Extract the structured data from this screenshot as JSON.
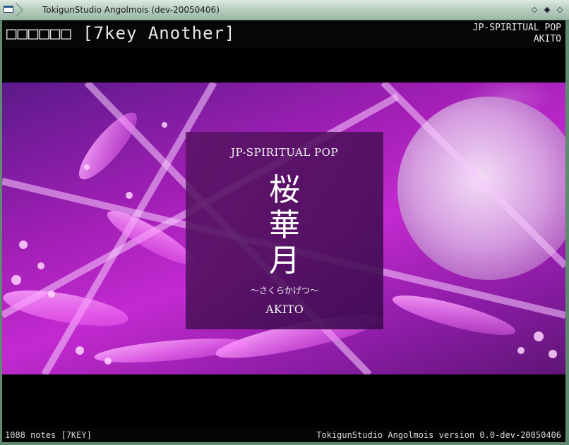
{
  "window": {
    "title": "TokigunStudio Angolmois (dev-20050406)",
    "frame_color": "#5f8a70"
  },
  "header": {
    "song_title": "□□□□□□ [7key Another]",
    "genre": "JP-SPIRITUAL POP",
    "artist": "AKITO"
  },
  "banner": {
    "genre": "JP-SPIRITUAL POP",
    "title_lines": [
      "桜",
      "華",
      "月"
    ],
    "reading": "～さくらかげつ～",
    "artist": "AKITO",
    "colors": {
      "primary": "#a21fb6",
      "light": "#f5a6ff",
      "dark": "#5b1a8a"
    }
  },
  "footer": {
    "notes": "1088 notes [7KEY]",
    "version": "TokigunStudio Angolmois version 0.0-dev-20050406"
  }
}
